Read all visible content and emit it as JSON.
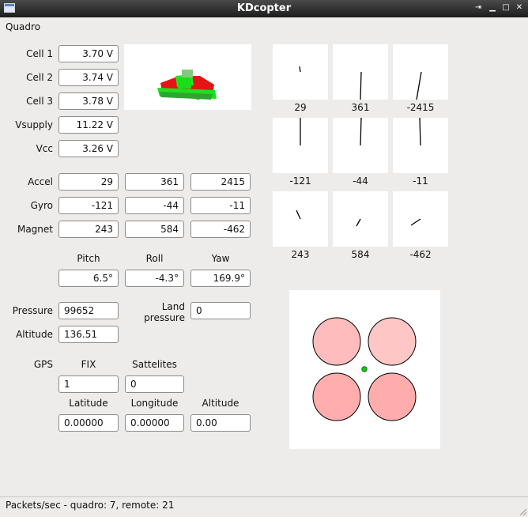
{
  "window": {
    "title": "KDcopter",
    "buttons": [
      "⇥",
      "▁",
      "□",
      "✕"
    ]
  },
  "menu": {
    "quadro": "Quadro"
  },
  "battery": {
    "labels": [
      "Cell 1",
      "Cell 2",
      "Cell 3",
      "Vsupply",
      "Vcc"
    ],
    "values": [
      "3.70 V",
      "3.74 V",
      "3.78 V",
      "11.22 V",
      "3.26 V"
    ]
  },
  "sensors": {
    "rows": [
      {
        "label": "Accel",
        "values": [
          "29",
          "361",
          "2415"
        ]
      },
      {
        "label": "Gyro",
        "values": [
          "-121",
          "-44",
          "-11"
        ]
      },
      {
        "label": "Magnet",
        "values": [
          "243",
          "584",
          "-462"
        ]
      }
    ]
  },
  "attitude": {
    "labels": [
      "Pitch",
      "Roll",
      "Yaw"
    ],
    "values": [
      "6.5°",
      "-4.3°",
      "169.9°"
    ]
  },
  "pressure": {
    "label": "Pressure",
    "value": "99652",
    "land_label_1": "Land",
    "land_label_2": "pressure",
    "land_value": "0",
    "alt_label": "Altitude",
    "alt_value": "136.51"
  },
  "gps": {
    "label": "GPS",
    "fix_label": "FIX",
    "fix_value": "1",
    "sat_label": "Sattelites",
    "sat_value": "0",
    "lat_label": "Latitude",
    "lat_value": "0.00000",
    "lon_label": "Longitude",
    "lon_value": "0.00000",
    "alt_label": "Altitude",
    "alt_value": "0.00"
  },
  "gauges": {
    "rows": [
      {
        "labels": [
          "29",
          "361",
          "-2415"
        ]
      },
      {
        "labels": [
          "-121",
          "-44",
          "-11"
        ]
      },
      {
        "labels": [
          "243",
          "584",
          "-462"
        ]
      }
    ]
  },
  "motors": {
    "rotor_colors": [
      "#ffbcbc",
      "#ffc6c6",
      "#ffadad",
      "#ffacac"
    ],
    "center_color": "#1fbf1f"
  },
  "status": {
    "text": "Packets/sec - quadro: 7, remote: 21"
  }
}
